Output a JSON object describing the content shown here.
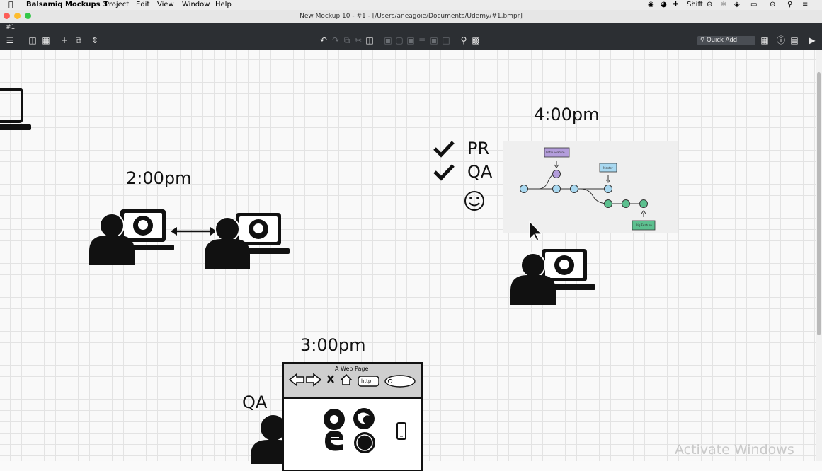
{
  "menubar": {
    "app_name": "Balsamiq Mockups 3",
    "items": [
      "Project",
      "Edit",
      "View",
      "Window",
      "Help"
    ],
    "status_shift": "Shift"
  },
  "window": {
    "title": "New Mockup 10 - #1 - [/Users/aneagoie/Documents/Udemy/#1.bmpr]",
    "tab": "#1"
  },
  "toolbar": {
    "quick_add": "Quick Add"
  },
  "canvas": {
    "time_2pm": "2:00pm",
    "time_3pm": "3:00pm",
    "time_4pm": "4:00pm",
    "check_pr": "PR",
    "check_qa": "QA",
    "qa_label": "QA",
    "browser_title": "A Web Page",
    "browser_url": "http:",
    "git": {
      "branch_little": "Little Feature",
      "branch_master": "Master",
      "branch_big": "Big Feature"
    }
  },
  "watermark": "Activate Windows",
  "colors": {
    "toolbar_bg": "#2c2f33",
    "git_purple": "#b39ddb",
    "git_blue": "#a8d8f0",
    "git_green": "#5cc08f"
  }
}
